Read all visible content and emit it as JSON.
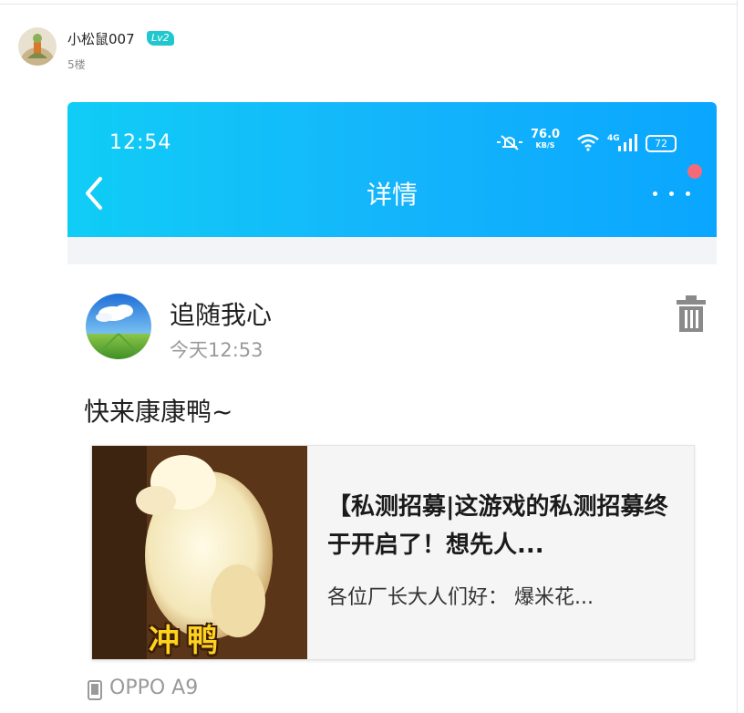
{
  "comment": {
    "username": "小松鼠007",
    "level": "Lv2",
    "floor": "5楼"
  },
  "phone": {
    "status_bar": {
      "time": "12:54",
      "net_speed_value": "76.0",
      "net_speed_unit": "KB/S",
      "signal_label": "4G",
      "battery": "72"
    },
    "nav": {
      "title": "详情"
    },
    "post": {
      "author": "追随我心",
      "time": "今天12:53",
      "text": "快来康康鸭~",
      "link_card": {
        "thumb_caption": "冲鸭",
        "title": "【私测招募|这游戏的私测招募终于开启了！想先人...",
        "description": "各位厂长大人们好： 爆米花..."
      },
      "device": "OPPO A9"
    }
  },
  "colors": {
    "header_gradient_start": "#10cdf6",
    "header_gradient_end": "#0aa6ff",
    "level_badge": "#20c7cf",
    "notification_dot": "#f36b78",
    "thumb_caption": "#ffd21f"
  },
  "icons": [
    "back-chevron-icon",
    "more-dots-icon",
    "trash-icon",
    "phone-device-icon",
    "mute-bell-icon",
    "wifi-icon",
    "signal-icon",
    "battery-icon"
  ]
}
